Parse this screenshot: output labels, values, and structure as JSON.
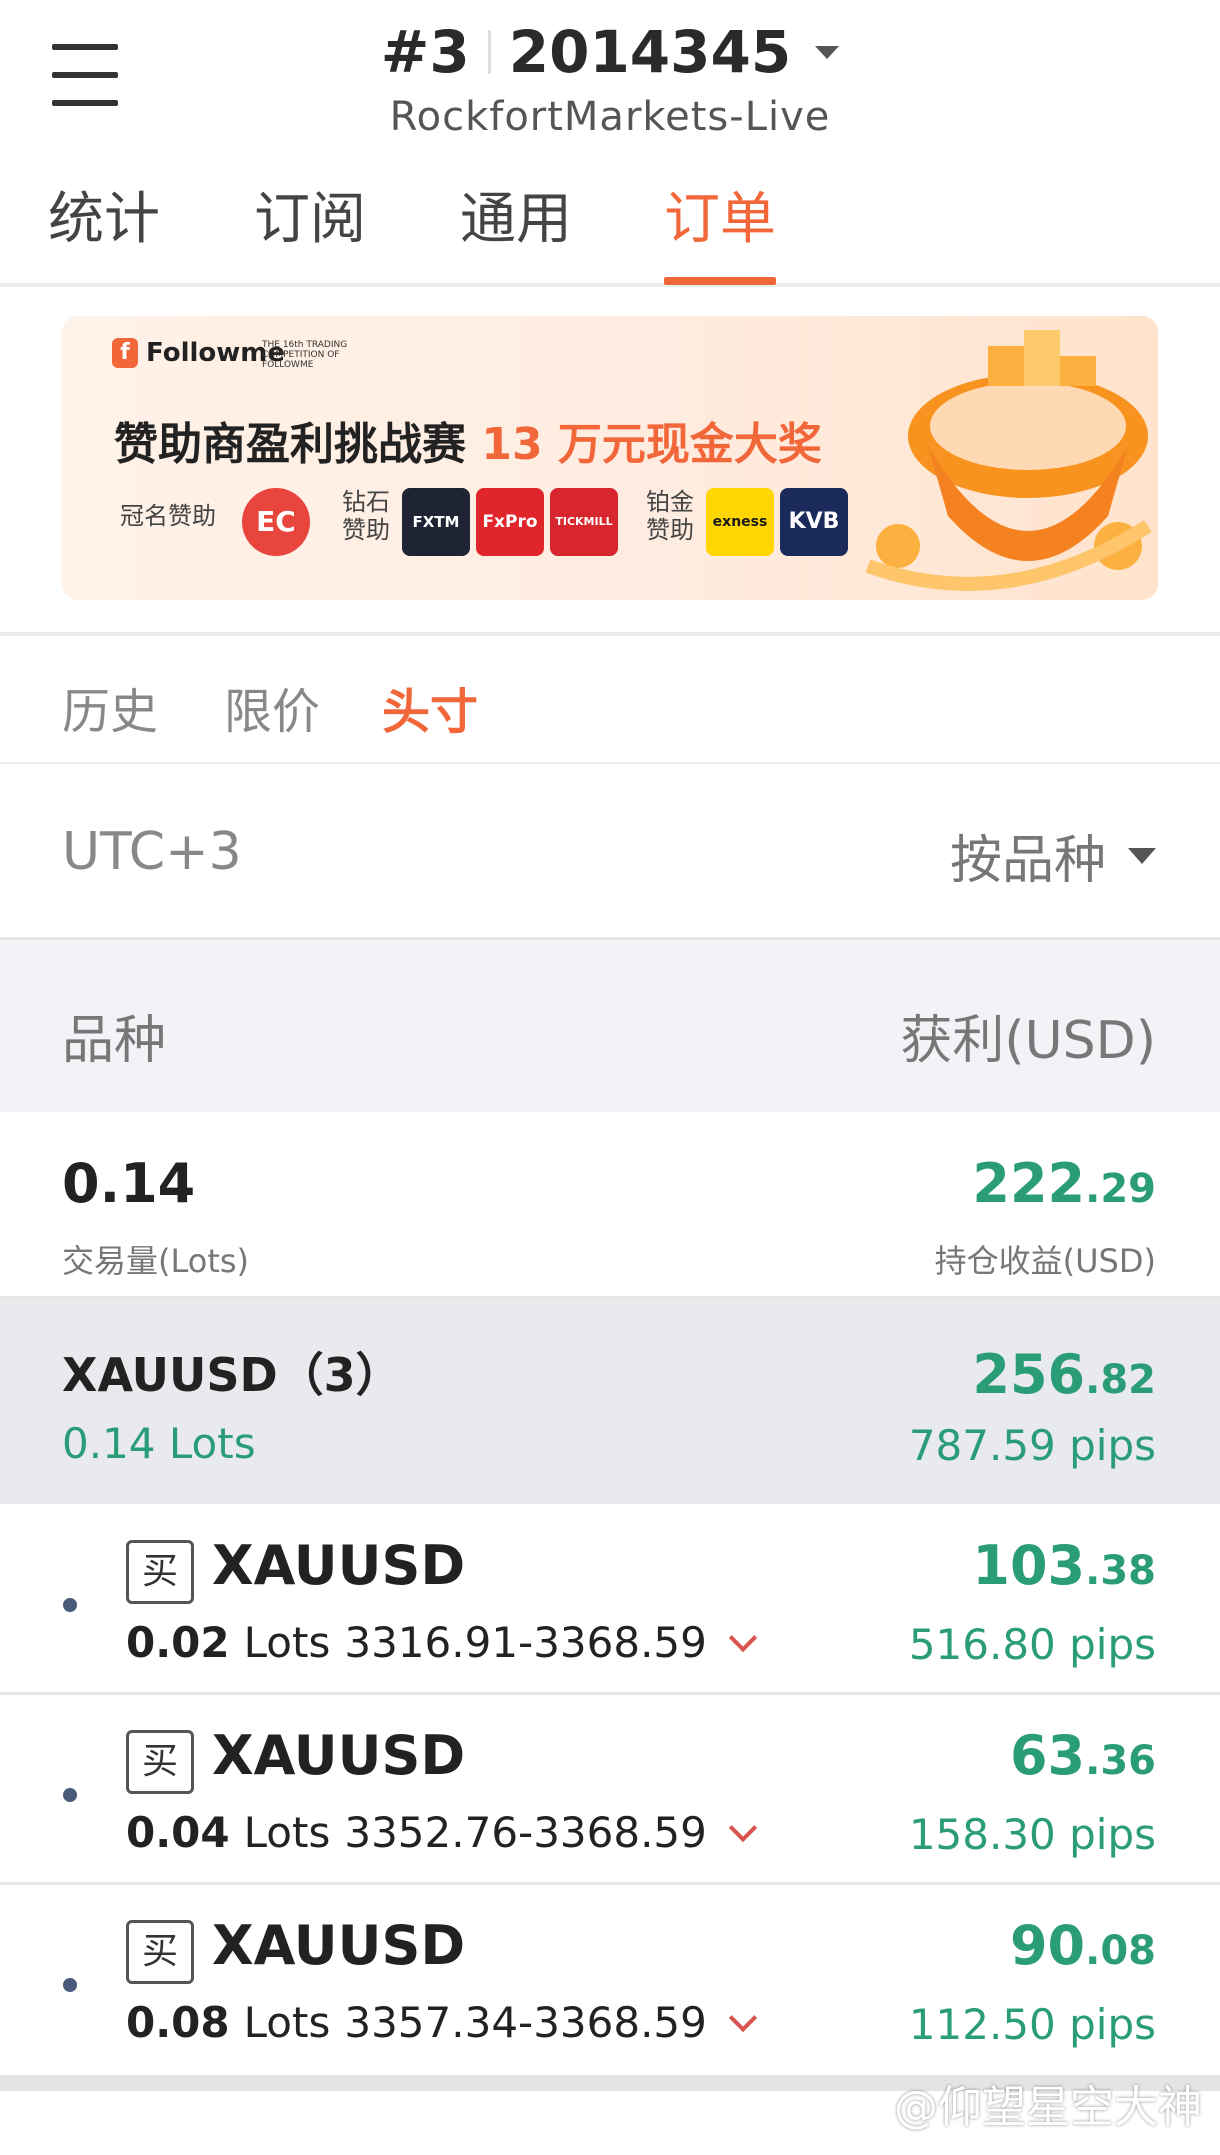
{
  "header": {
    "account_number": "#3",
    "account_id": "2014345",
    "server": "RockfortMarkets-Live"
  },
  "tabs": [
    "统计",
    "订阅",
    "通用",
    "订单"
  ],
  "active_tab": "订单",
  "banner": {
    "brand": "Followme",
    "competition_text": "THE 16th TRADING COMPETITION OF FOLLOWME",
    "title_main": "赞助商盈利挑战赛",
    "title_highlight": "13 万元现金大奖",
    "title_sponsor_label": "冠名赞助",
    "title_sponsor": "EC",
    "diamond_label": "钻石赞助",
    "diamond_sponsors": [
      "FXTM",
      "FxPro",
      "TICKMILL"
    ],
    "platinum_label": "铂金赞助",
    "platinum_sponsors": [
      "exness",
      "KVB"
    ]
  },
  "subtabs": [
    "历史",
    "限价",
    "头寸"
  ],
  "active_subtab": "头寸",
  "filter": {
    "timezone": "UTC+3",
    "sort": "按品种"
  },
  "table_header": {
    "left": "品种",
    "right": "获利(USD)"
  },
  "summary": {
    "volume": "0.14",
    "volume_label": "交易量(Lots)",
    "profit_int": "222",
    "profit_dec": ".29",
    "profit_label": "持仓收益(USD)"
  },
  "group": {
    "symbol": "XAUUSD（3）",
    "lots": "0.14 Lots",
    "profit_int": "256",
    "profit_dec": ".82",
    "pips": "787.59 pips"
  },
  "positions": [
    {
      "side": "买",
      "symbol": "XAUUSD",
      "lots": "0.02",
      "lots_unit": "Lots",
      "range": "3316.91-3368.59",
      "profit_int": "103",
      "profit_dec": ".38",
      "pips": "516.80 pips"
    },
    {
      "side": "买",
      "symbol": "XAUUSD",
      "lots": "0.04",
      "lots_unit": "Lots",
      "range": "3352.76-3368.59",
      "profit_int": "63",
      "profit_dec": ".36",
      "pips": "158.30 pips"
    },
    {
      "side": "买",
      "symbol": "XAUUSD",
      "lots": "0.08",
      "lots_unit": "Lots",
      "range": "3357.34-3368.59",
      "profit_int": "90",
      "profit_dec": ".08",
      "pips": "112.50 pips"
    }
  ],
  "watermark": "@仰望星空大神",
  "colors": {
    "accent": "#f2673a",
    "profit": "#2a9d78",
    "loss_arrow": "#d9534f"
  }
}
